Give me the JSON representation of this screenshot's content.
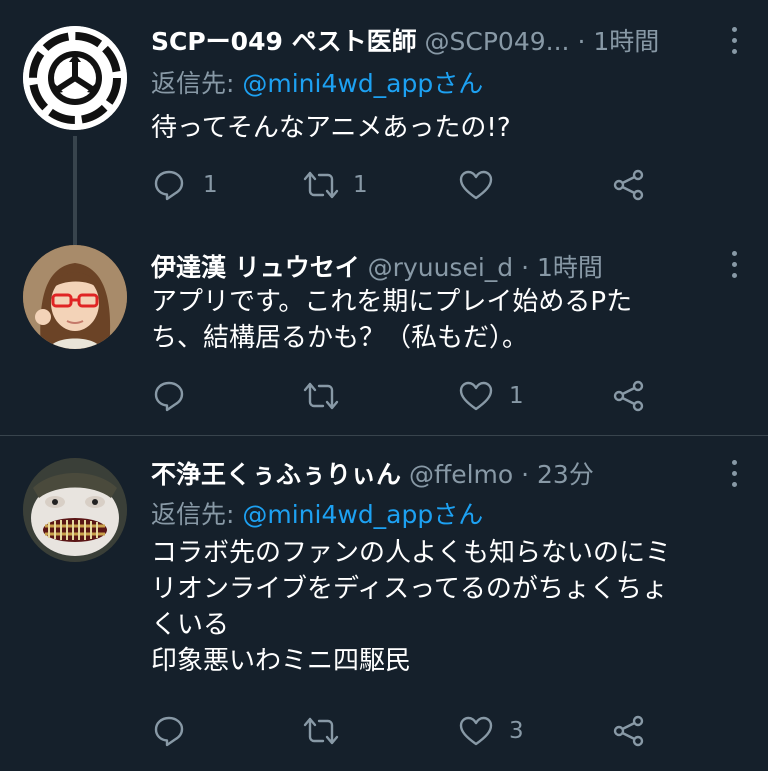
{
  "tweets": [
    {
      "name": "SCPー049 ペスト医師",
      "handle": "@SCP049...",
      "separator": "·",
      "time": "1時間",
      "reply_label": "返信先: ",
      "reply_mention": "@mini4wd_appさん",
      "lines": [
        "待ってそんなアニメあったの!?"
      ],
      "reply_count": "1",
      "retweet_count": "1",
      "like_count": ""
    },
    {
      "name": "伊達漢 リュウセイ",
      "handle": "@ryuusei_d",
      "separator": "·",
      "time": "1時間",
      "lines": [
        "アプリです。これを期にプレイ始めるPた",
        "ち、結構居るかも？（私もだ）。"
      ],
      "reply_count": "",
      "retweet_count": "",
      "like_count": "1"
    },
    {
      "name": "不浄王くぅふぅりぃん",
      "handle": "@ffelmo",
      "separator": "·",
      "time": "23分",
      "reply_label": "返信先: ",
      "reply_mention": "@mini4wd_appさん",
      "lines": [
        "コラボ先のファンの人よくも知らないのにミ",
        "リオンライブをディスってるのがちょくちょ",
        "くいる",
        "印象悪いわミニ四駆民"
      ],
      "reply_count": "",
      "retweet_count": "",
      "like_count": "3"
    }
  ],
  "icons": {
    "reply": "reply-icon",
    "retweet": "retweet-icon",
    "like": "heart-icon",
    "share": "share-icon",
    "more": "more-icon"
  },
  "colors": {
    "background": "#15202b",
    "secondary_text": "#8899a6",
    "link": "#1da1f2",
    "divider": "#38444d"
  }
}
